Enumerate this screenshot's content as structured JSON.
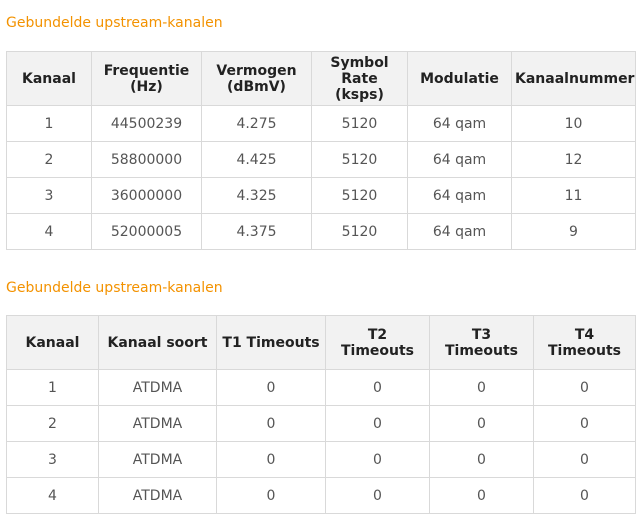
{
  "upstream_table": {
    "title": "Gebundelde upstream-kanalen",
    "headers": [
      "Kanaal",
      "Frequentie (Hz)",
      "Vermogen (dBmV)",
      "Symbol Rate (ksps)",
      "Modulatie",
      "Kanaalnummer"
    ],
    "rows": [
      [
        "1",
        "44500239",
        "4.275",
        "5120",
        "64 qam",
        "10"
      ],
      [
        "2",
        "58800000",
        "4.425",
        "5120",
        "64 qam",
        "12"
      ],
      [
        "3",
        "36000000",
        "4.325",
        "5120",
        "64 qam",
        "11"
      ],
      [
        "4",
        "52000005",
        "4.375",
        "5120",
        "64 qam",
        "9"
      ]
    ]
  },
  "timeouts_table": {
    "title": "Gebundelde upstream-kanalen",
    "headers": [
      "Kanaal",
      "Kanaal soort",
      "T1 Timeouts",
      "T2 Timeouts",
      "T3 Timeouts",
      "T4 Timeouts"
    ],
    "rows": [
      [
        "1",
        "ATDMA",
        "0",
        "0",
        "0",
        "0"
      ],
      [
        "2",
        "ATDMA",
        "0",
        "0",
        "0",
        "0"
      ],
      [
        "3",
        "ATDMA",
        "0",
        "0",
        "0",
        "0"
      ],
      [
        "4",
        "ATDMA",
        "0",
        "0",
        "0",
        "0"
      ]
    ]
  },
  "colors": {
    "title_accent": "#f39200",
    "header_background": "#f2f2f2",
    "border": "#d9d9d9"
  }
}
